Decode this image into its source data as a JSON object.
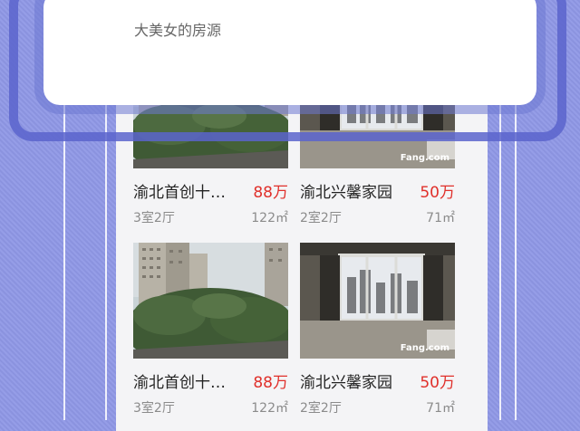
{
  "header": {
    "title": "大美女的房源"
  },
  "listings": [
    {
      "name": "渝北首创十…",
      "price": "88万",
      "rooms": "3室2厅",
      "area": "122㎡",
      "photo": "tower-view"
    },
    {
      "name": "渝北兴馨家园",
      "price": "50万",
      "rooms": "2室2厅",
      "area": "71㎡",
      "photo": "living-room-window"
    },
    {
      "name": "渝北首创十…",
      "price": "88万",
      "rooms": "3室2厅",
      "area": "122㎡",
      "photo": "tower-view"
    },
    {
      "name": "渝北兴馨家园",
      "price": "50万",
      "rooms": "2室2厅",
      "area": "71㎡",
      "photo": "living-room-window"
    }
  ],
  "watermark": "Fang.com",
  "colors": {
    "background": "#8f98e6",
    "price": "#e0302b",
    "frame": "#5a64cd"
  }
}
